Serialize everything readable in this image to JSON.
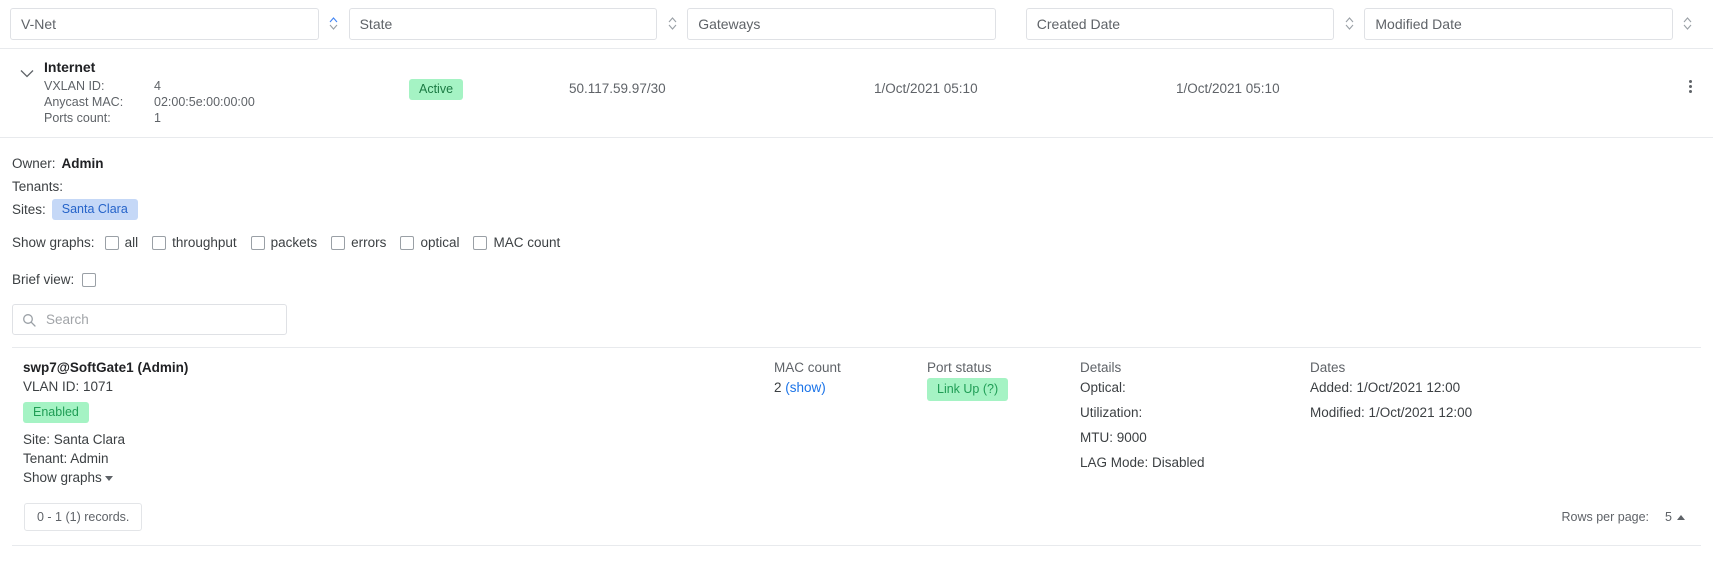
{
  "filters": [
    {
      "name": "vnet",
      "placeholder": "V-Net",
      "value": "",
      "sort_icon": "sort-arrows-icon"
    },
    {
      "name": "state",
      "placeholder": "State",
      "value": "",
      "sort_icon": "sort-arrows-icon"
    },
    {
      "name": "gateways",
      "placeholder": "Gateways",
      "value": "",
      "sort_icon": ""
    },
    {
      "name": "created_date",
      "placeholder": "Created Date",
      "value": "",
      "sort_icon": "sort-arrows-icon"
    },
    {
      "name": "modified_date",
      "placeholder": "Modified Date",
      "value": "",
      "sort_icon": "sort-arrows-icon"
    }
  ],
  "vnet": {
    "expand_icon": "chevron-down-icon",
    "title": "Internet",
    "fields": [
      {
        "label": "VXLAN ID:",
        "value": "4"
      },
      {
        "label": "Anycast MAC:",
        "value": "02:00:5e:00:00:00"
      },
      {
        "label": "Ports count:",
        "value": "1"
      }
    ],
    "state": "Active",
    "gateway": "50.117.59.97/30",
    "created_date": "1/Oct/2021 05:10",
    "modified_date": "1/Oct/2021 05:10",
    "menu_icon": "kebab-menu-icon"
  },
  "detail": {
    "owner_label": "Owner:",
    "owner_value": "Admin",
    "tenants_label": "Tenants:",
    "tenants_value": "",
    "sites_label": "Sites:",
    "site_chip": "Santa Clara",
    "show_graphs_label": "Show graphs:",
    "graph_options": [
      {
        "label": "all",
        "checked": false
      },
      {
        "label": "throughput",
        "checked": false
      },
      {
        "label": "packets",
        "checked": false
      },
      {
        "label": "errors",
        "checked": false
      },
      {
        "label": "optical",
        "checked": false
      },
      {
        "label": "MAC count",
        "checked": false
      }
    ],
    "brief_view_label": "Brief view:",
    "brief_view_checked": false
  },
  "search": {
    "icon": "search-icon",
    "placeholder": "Search",
    "value": ""
  },
  "port_table": {
    "headers": {
      "port": "",
      "mac_count": "MAC count",
      "port_status": "Port status",
      "details": "Details",
      "dates": "Dates"
    },
    "row": {
      "name": "swp7@SoftGate1 (Admin)",
      "vlan": "VLAN ID: 1071",
      "status_badge": "Enabled",
      "site": "Site: Santa Clara",
      "tenant": "Tenant: Admin",
      "show_graphs": "Show graphs",
      "show_graphs_icon": "caret-down-icon",
      "mac_count_value": "2",
      "mac_count_link": "(show)",
      "port_status_badge": "Link Up (?)",
      "details": [
        "Optical:",
        "Utilization:",
        "MTU: 9000",
        "LAG Mode: Disabled"
      ],
      "dates": [
        "Added: 1/Oct/2021 12:00",
        "Modified: 1/Oct/2021 12:00"
      ]
    }
  },
  "footer": {
    "records": "0 - 1 (1) records.",
    "rows_per_page_label": "Rows per page:",
    "rows_per_page_value": "5",
    "rows_per_page_icon": "caret-up-icon"
  },
  "colors": {
    "accent_blue": "#1a73e8",
    "badge_green_bg": "#a5f3c4",
    "badge_green_text": "#1f9d55",
    "chip_blue_bg": "#c5d8f7",
    "chip_blue_text": "#2563c9",
    "border": "#e8eaed"
  }
}
